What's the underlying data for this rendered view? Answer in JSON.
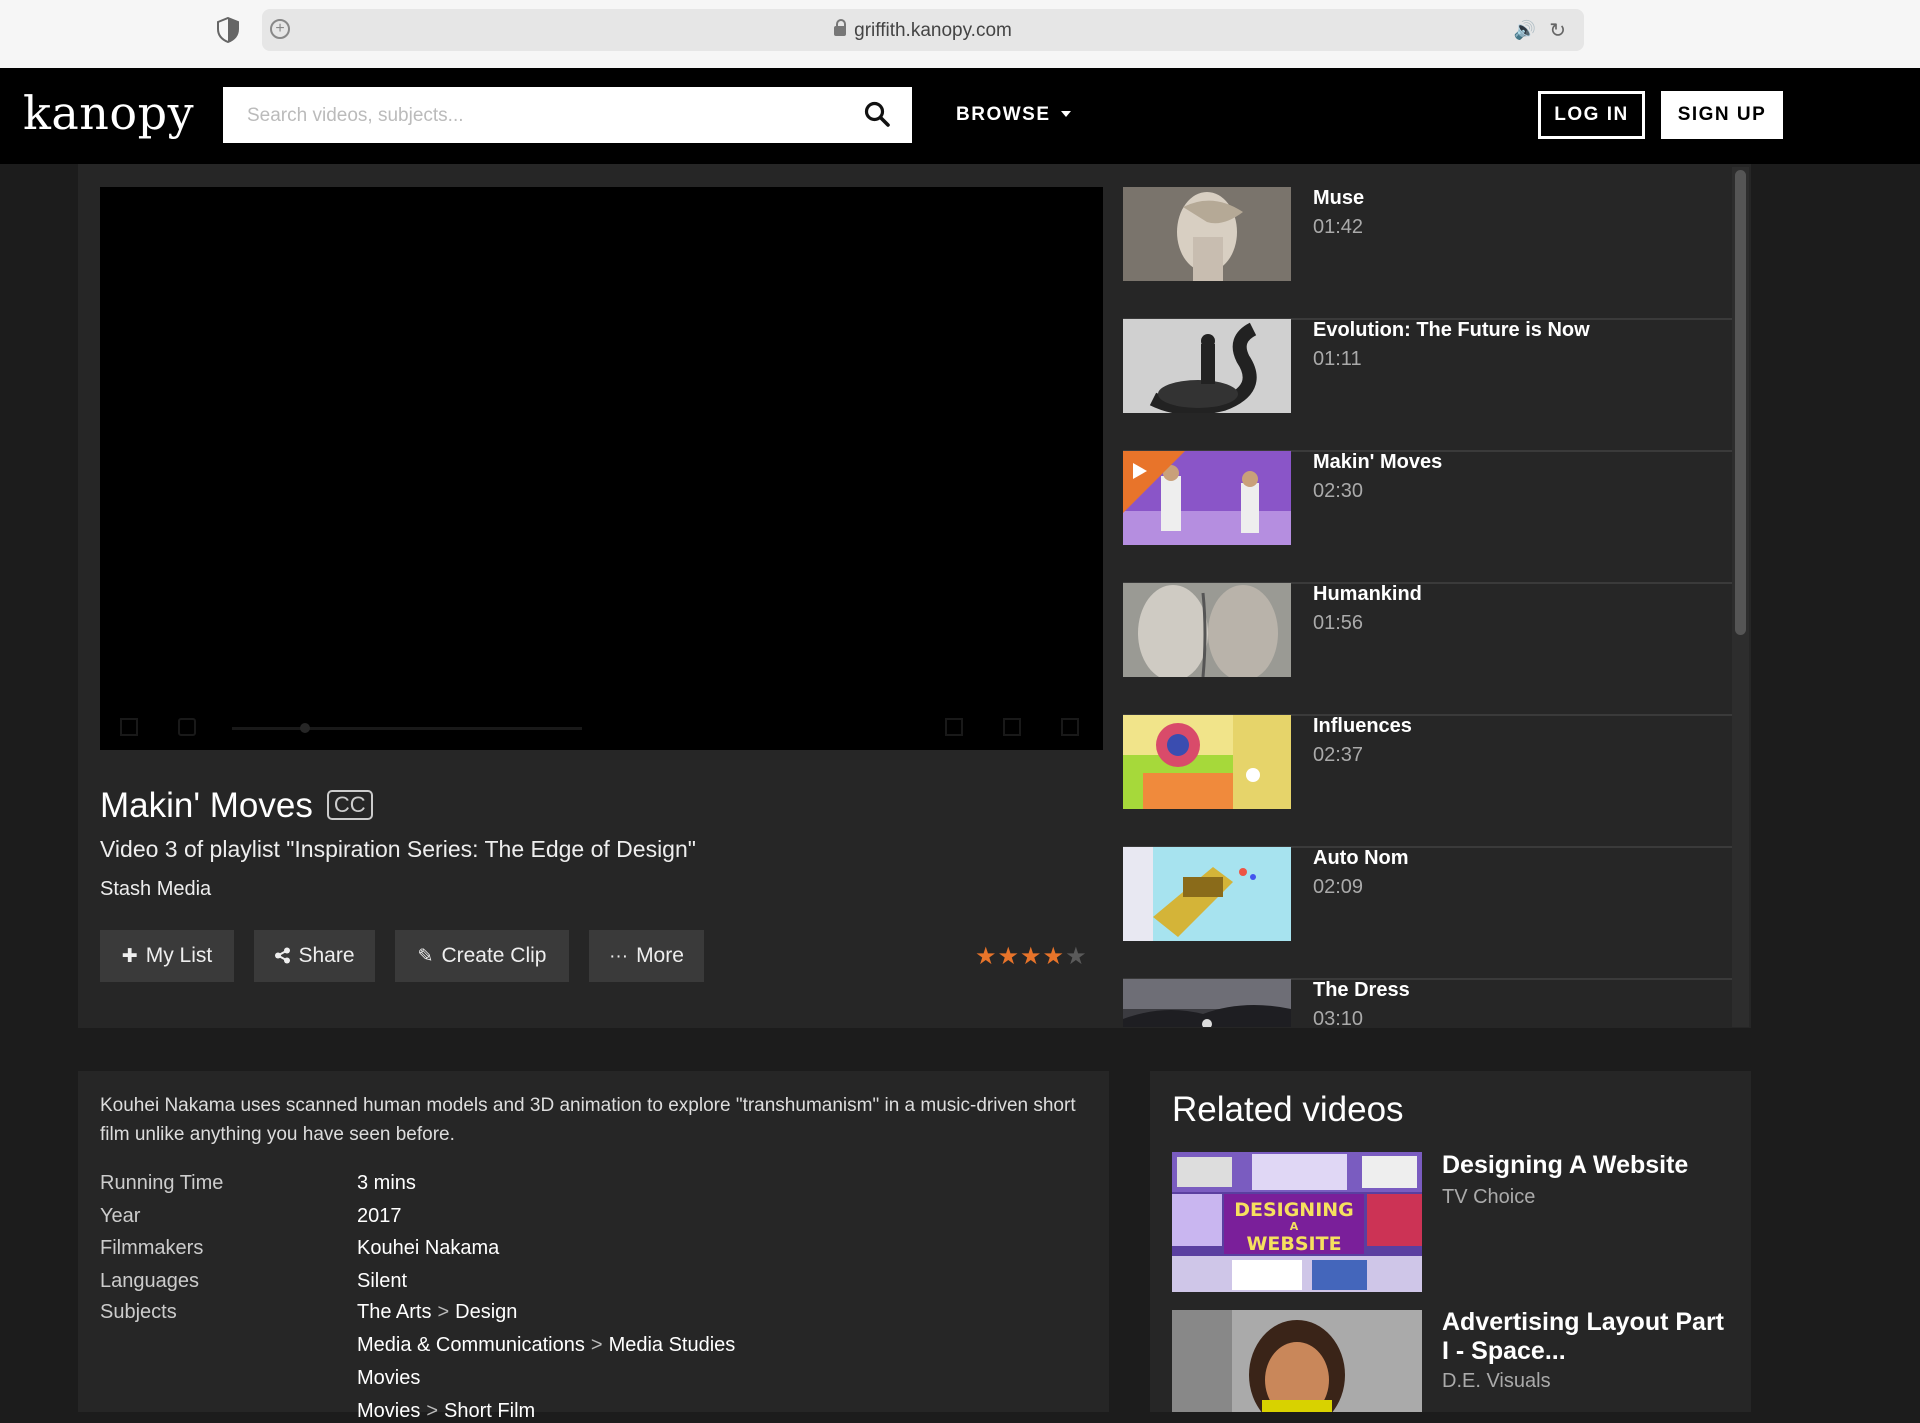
{
  "browser": {
    "url": "griffith.kanopy.com"
  },
  "header": {
    "logo": "kanopy",
    "search_placeholder": "Search videos, subjects...",
    "browse_label": "BROWSE",
    "login_label": "LOG IN",
    "signup_label": "SIGN UP"
  },
  "video": {
    "title": "Makin' Moves",
    "cc_label": "CC",
    "playlist_info": "Video 3 of playlist \"Inspiration Series: The Edge of Design\"",
    "producer": "Stash Media",
    "rating": 4,
    "rating_max": 5
  },
  "actions": {
    "my_list": "My List",
    "share": "Share",
    "create_clip": "Create Clip",
    "more": "More"
  },
  "playlist": [
    {
      "name": "Muse",
      "duration": "01:42"
    },
    {
      "name": "Evolution: The Future is Now",
      "duration": "01:11"
    },
    {
      "name": "Makin' Moves",
      "duration": "02:30",
      "playing": true
    },
    {
      "name": "Humankind",
      "duration": "01:56"
    },
    {
      "name": "Influences",
      "duration": "02:37"
    },
    {
      "name": "Auto Nom",
      "duration": "02:09"
    },
    {
      "name": "The Dress",
      "duration": "03:10"
    }
  ],
  "description": "Kouhei Nakama uses scanned human models and 3D animation to explore \"transhumanism\" in a music-driven short film unlike anything you have seen before.",
  "details": {
    "running_time_label": "Running Time",
    "running_time": "3 mins",
    "year_label": "Year",
    "year": "2017",
    "filmmakers_label": "Filmmakers",
    "filmmakers": "Kouhei Nakama",
    "languages_label": "Languages",
    "languages": "Silent",
    "subjects_label": "Subjects",
    "subjects": [
      {
        "a": "The Arts",
        "b": "Design"
      },
      {
        "a": "Media & Communications",
        "b": "Media Studies"
      },
      {
        "a": "Movies"
      },
      {
        "a": "Movies",
        "b": "Short Film"
      }
    ]
  },
  "related": {
    "title": "Related videos",
    "items": [
      {
        "name": "Designing A Website",
        "by": "TV Choice",
        "thumb_text": [
          "DESIGNING",
          "A",
          "WEBSITE"
        ]
      },
      {
        "name": "Advertising Layout Part I - Space...",
        "by": "D.E. Visuals"
      }
    ]
  },
  "colors": {
    "accent": "#e8742a",
    "background": "#1c1c1c",
    "panel": "#262626"
  }
}
